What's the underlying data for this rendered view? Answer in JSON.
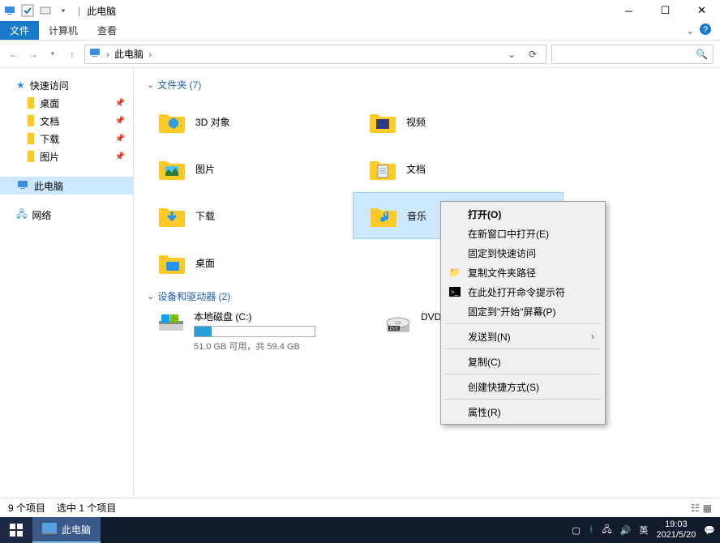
{
  "titlebar": {
    "title": "此电脑",
    "sep": "|"
  },
  "ribbon": {
    "file": "文件",
    "computer": "计算机",
    "view": "查看"
  },
  "nav": {
    "location": "此电脑",
    "crumb_sep": "›"
  },
  "sidebar": {
    "quick": "快速访问",
    "items": [
      {
        "label": "桌面"
      },
      {
        "label": "文档"
      },
      {
        "label": "下载"
      },
      {
        "label": "图片"
      }
    ],
    "thispc": "此电脑",
    "network": "网络"
  },
  "sections": {
    "folders": "文件夹 (7)",
    "devices": "设备和驱动器 (2)"
  },
  "folders": [
    {
      "name": "3D 对象",
      "icon": "3d"
    },
    {
      "name": "视频",
      "icon": "video"
    },
    {
      "name": "图片",
      "icon": "pictures"
    },
    {
      "name": "文档",
      "icon": "documents"
    },
    {
      "name": "下载",
      "icon": "downloads"
    },
    {
      "name": "音乐",
      "icon": "music",
      "selected": true
    },
    {
      "name": "桌面",
      "icon": "desktop"
    }
  ],
  "drives": [
    {
      "name": "本地磁盘 (C:)",
      "sub": "51.0 GB 可用，共 59.4 GB",
      "pct": 14
    },
    {
      "name": "DVD 驱",
      "sub": ""
    }
  ],
  "context_menu": {
    "open": "打开(O)",
    "open_new": "在新窗口中打开(E)",
    "pin_quick": "固定到快速访问",
    "copy_path": "复制文件夹路径",
    "open_cmd": "在此处打开命令提示符",
    "pin_start": "固定到\"开始\"屏幕(P)",
    "send_to": "发送到(N)",
    "copy": "复制(C)",
    "create_shortcut": "创建快捷方式(S)",
    "properties": "属性(R)"
  },
  "statusbar": {
    "count": "9 个项目",
    "selected": "选中 1 个项目"
  },
  "taskbar": {
    "app": "此电脑",
    "ime": "英",
    "time": "19:03",
    "date": "2021/5/20"
  }
}
